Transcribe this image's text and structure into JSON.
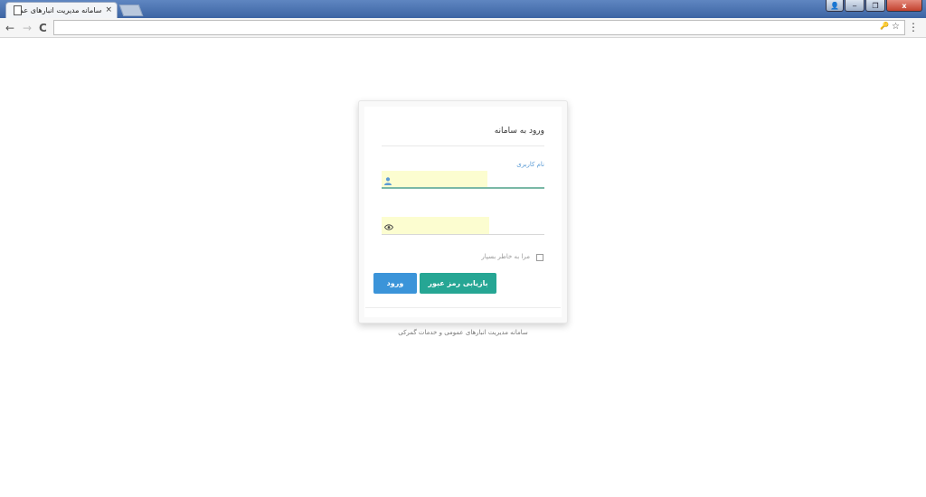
{
  "browser": {
    "tab_title": "سامانه مدیریت انبارهای عمومی",
    "tab_close": "×",
    "nav_back": "←",
    "nav_forward": "→",
    "nav_reload": "C",
    "key_icon": "🔑",
    "star_icon": "☆",
    "menu_icon": "⋮",
    "window_controls": {
      "person": "👤",
      "minimize": "‒",
      "restore": "❐",
      "close": "x"
    },
    "address_value": ""
  },
  "login": {
    "title": "ورود به سامانه",
    "username_label": "نام کاربری",
    "username_value": "",
    "password_value": "",
    "remember_label": "مرا به خاطر بسپار",
    "login_button": "ورود",
    "recover_button": "بازیابی رمز عبور"
  },
  "footer": {
    "text": "سامانه مدیریت انبارهای عمومی و خدمات گمرکی"
  },
  "colors": {
    "login_button": "#3b94d9",
    "recover_button": "#26a694",
    "label_accent": "#5b9bd5",
    "autofill": "#fcfdd0"
  }
}
